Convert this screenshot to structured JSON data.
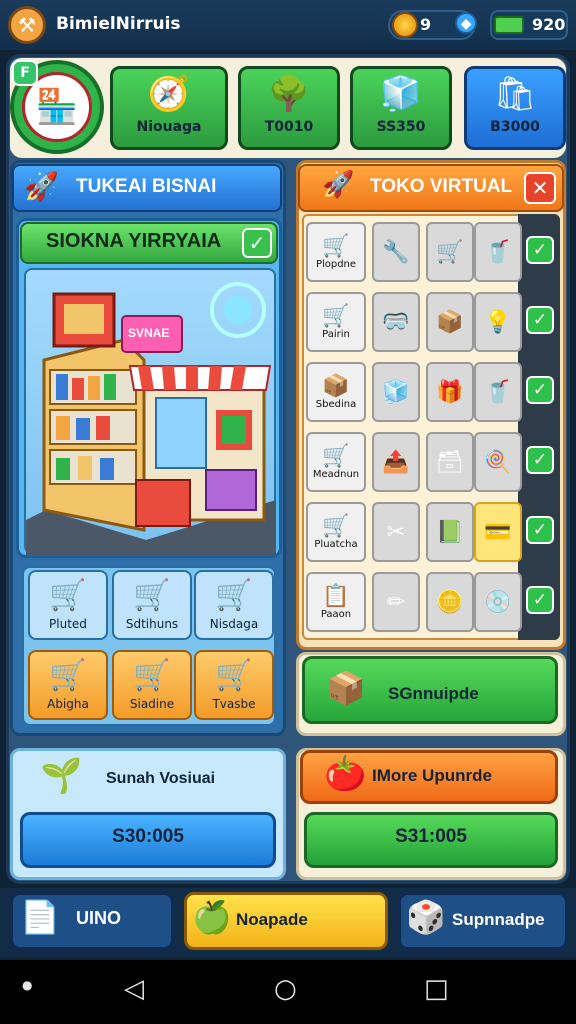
{
  "top_bar": {
    "title": "BimielNirruis",
    "coin_value": "9",
    "energy_value": "920",
    "icons": [
      "tools-icon",
      "coin-icon",
      "gem-icon",
      "battery-icon"
    ]
  },
  "header": {
    "level_badge": "F",
    "cards": [
      {
        "label": "Niouaga",
        "icon": "compass-icon"
      },
      {
        "label": "T0010",
        "icon": "bush-icon"
      },
      {
        "label": "SS350",
        "icon": "package-icon"
      },
      {
        "label": "B3000",
        "icon": "bag-icon"
      }
    ]
  },
  "left_panel": {
    "title": "TUKEAI BISNAI",
    "store_card_title": "SIOKNA YIRRYAIA",
    "store_sign": "SVNAE",
    "carts": [
      {
        "label": "Pluted"
      },
      {
        "label": "Sdtihuns"
      },
      {
        "label": "Nisdaga"
      },
      {
        "label": "Abigha"
      },
      {
        "label": "Siadine"
      },
      {
        "label": "Tvasbe"
      }
    ]
  },
  "right_panel": {
    "title": "TOKO VIRTUAL",
    "rows": [
      {
        "name": "Plopdne",
        "items": [
          "cart",
          "wrench",
          "cart-gray",
          "cup"
        ]
      },
      {
        "name": "Pairin",
        "items": [
          "cart-red",
          "goggles",
          "box",
          "bulb"
        ]
      },
      {
        "name": "Sbedina",
        "items": [
          "box-purple",
          "box-blue",
          "gift",
          "cup-pink"
        ]
      },
      {
        "name": "Meadnun",
        "items": [
          "cart-blue",
          "crate",
          "crate-brown",
          "lollipop"
        ]
      },
      {
        "name": "Pluatcha",
        "items": [
          "cart-red",
          "scissors",
          "book",
          "card"
        ]
      },
      {
        "name": "Paaon",
        "items": [
          "clipboard",
          "pencil",
          "coins",
          "disc"
        ]
      }
    ],
    "upgrade_label": "SGnnuipde"
  },
  "bottom_left": {
    "label": "Sunah Vosiuai",
    "price": "S30:005"
  },
  "bottom_right": {
    "label": "IMore Upunrde",
    "price": "S31:005"
  },
  "action_bar": {
    "left_label": "UINO",
    "middle_label": "Noapade",
    "right_label": "Supnnadpe"
  },
  "colors": {
    "accent_green": "#2fb34a",
    "accent_blue": "#2471d3",
    "accent_orange": "#f07719",
    "background": "#0f2236"
  }
}
